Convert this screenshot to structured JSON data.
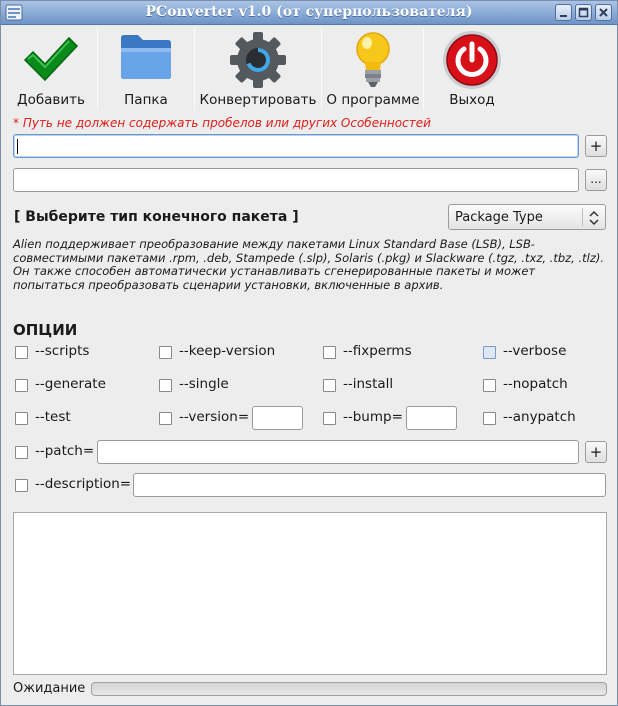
{
  "window": {
    "title": "PConverter v1.0 (от суперпользователя)"
  },
  "toolbar": {
    "add_label": "Добавить",
    "folder_label": "Папка",
    "convert_label": "Конвертировать",
    "about_label": "О программе",
    "exit_label": "Выход"
  },
  "warning": "* Путь не должен содержать пробелов или других Особенностей",
  "inputs": {
    "source_value": "",
    "target_value": ""
  },
  "buttons": {
    "plus": "+",
    "browse": "...",
    "patch_plus": "+"
  },
  "package": {
    "heading": "[ Выберите тип конечного пакета ]",
    "select_value": "Package Type"
  },
  "description": "Alien поддерживает преобразование между пакетами Linux Standard Base (LSB), LSB-совместимыми пакетами .rpm, .deb, Stampede (.slp), Solaris (.pkg) и Slackware (.tgz, .txz, .tbz, .tlz). Он также способен автоматически устанавливать сгенерированные пакеты и может попытаться преобразовать сценарии установки, включенные в архив.",
  "options": {
    "heading": "ОПЦИИ",
    "scripts": "--scripts",
    "keep_version": "--keep-version",
    "fixperms": "--fixperms",
    "verbose": "--verbose",
    "generate": "--generate",
    "single": "--single",
    "install": "--install",
    "nopatch": "--nopatch",
    "test": "--test",
    "version": "--version=",
    "bump": "--bump=",
    "anypatch": "--anypatch",
    "patch": "--patch=",
    "description": "--description=",
    "version_value": "",
    "bump_value": "",
    "patch_value": "",
    "description_value": ""
  },
  "status": {
    "label": "Ожидание",
    "progress": 0
  },
  "colors": {
    "accent": "#6f94c8",
    "warning": "#e0201a",
    "check_green": "#0b8a1c",
    "exit_red": "#d8101a"
  },
  "icons": {
    "add": "checkmark-icon",
    "folder": "folder-icon",
    "convert": "gear-icon",
    "about": "lightbulb-icon",
    "exit": "power-icon"
  }
}
